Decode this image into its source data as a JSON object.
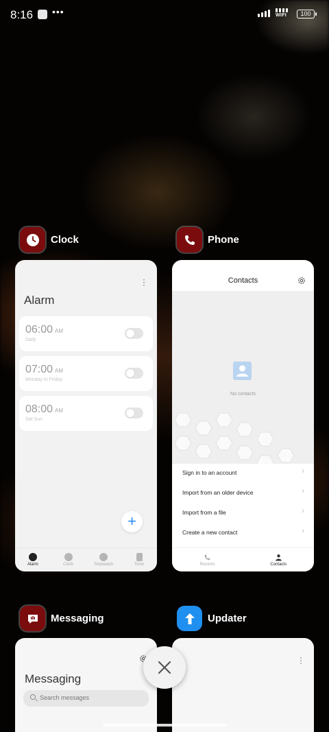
{
  "status_bar": {
    "time": "8:16",
    "wifi_label": "WIFI",
    "battery": "100"
  },
  "apps": {
    "clock": {
      "name": "Clock",
      "title": "Alarm",
      "alarms": [
        {
          "time": "06:00",
          "ampm": "AM",
          "repeat": "Daily",
          "enabled": false
        },
        {
          "time": "07:00",
          "ampm": "AM",
          "repeat": "Monday to Friday",
          "enabled": false
        },
        {
          "time": "08:00",
          "ampm": "AM",
          "repeat": "Sat Sun",
          "enabled": false
        }
      ],
      "fab": "+",
      "nav": [
        "Alarm",
        "Clock",
        "Stopwatch",
        "Timer"
      ]
    },
    "phone": {
      "name": "Phone",
      "title": "Contacts",
      "empty_text": "No contacts",
      "menu": [
        "Sign in to an account",
        "Import from an older device",
        "Import from a file",
        "Create a new contact"
      ],
      "nav": [
        "Recents",
        "Contacts"
      ]
    },
    "messaging": {
      "name": "Messaging",
      "title": "Messaging",
      "search_placeholder": "Search messages"
    },
    "updater": {
      "name": "Updater"
    }
  },
  "colors": {
    "clock_icon_bg": "#7a0c0e",
    "updater_icon_bg": "#1f8ff0",
    "fab_accent": "#2d8cf0"
  }
}
